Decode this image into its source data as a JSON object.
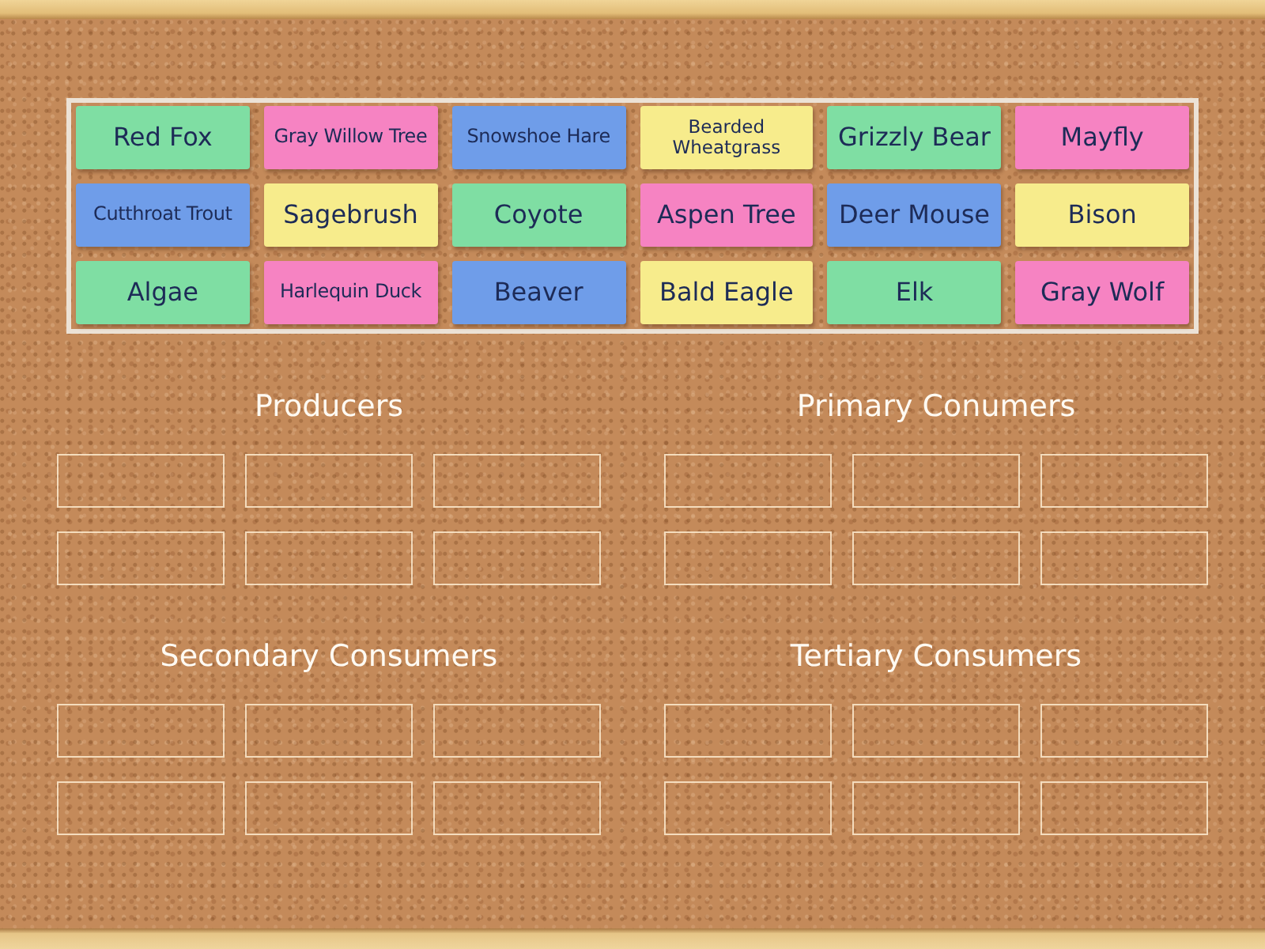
{
  "cards": [
    {
      "label": "Red Fox",
      "color": "#7fdea3"
    },
    {
      "label": "Gray Willow Tree",
      "color": "#f683c2"
    },
    {
      "label": "Snowshoe Hare",
      "color": "#6f9de9"
    },
    {
      "label": "Bearded Wheatgrass",
      "color": "#f7ec8c"
    },
    {
      "label": "Grizzly Bear",
      "color": "#7fdea3"
    },
    {
      "label": "Mayfly",
      "color": "#f683c2"
    },
    {
      "label": "Cutthroat Trout",
      "color": "#6f9de9"
    },
    {
      "label": "Sagebrush",
      "color": "#f7ec8c"
    },
    {
      "label": "Coyote",
      "color": "#7fdea3"
    },
    {
      "label": "Aspen Tree",
      "color": "#f683c2"
    },
    {
      "label": "Deer Mouse",
      "color": "#6f9de9"
    },
    {
      "label": "Bison",
      "color": "#f7ec8c"
    },
    {
      "label": "Algae",
      "color": "#7fdea3"
    },
    {
      "label": "Harlequin Duck",
      "color": "#f683c2"
    },
    {
      "label": "Beaver",
      "color": "#6f9de9"
    },
    {
      "label": "Bald Eagle",
      "color": "#f7ec8c"
    },
    {
      "label": "Elk",
      "color": "#7fdea3"
    },
    {
      "label": "Gray Wolf",
      "color": "#f683c2"
    }
  ],
  "categories": [
    {
      "title": "Producers"
    },
    {
      "title": "Primary Conumers"
    },
    {
      "title": "Secondary Consumers"
    },
    {
      "title": "Tertiary Consumers"
    }
  ]
}
